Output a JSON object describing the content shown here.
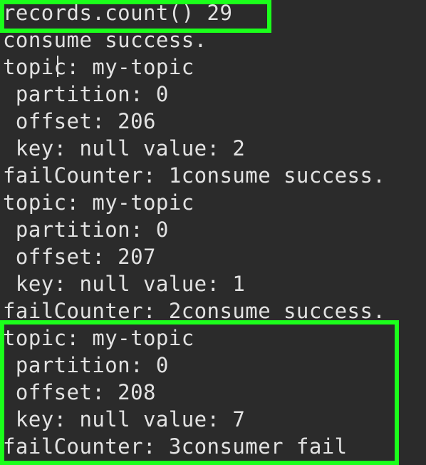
{
  "terminal": {
    "lines": [
      "records.count() 29",
      "consume success.",
      "topic: my-topic",
      " partition: 0",
      " offset: 206",
      " key: null value: 2",
      "failCounter: 1consume success.",
      "topic: my-topic",
      " partition: 0",
      " offset: 207",
      " key: null value: 1",
      "failCounter: 2consume success.",
      "topic: my-topic",
      " partition: 0",
      " offset: 208",
      " key: null value: 7",
      "failCounter: 3consumer fail"
    ]
  },
  "colors": {
    "background": "#2b2b2b",
    "text": "#e2e2e2",
    "highlight": "#1bff1b"
  }
}
